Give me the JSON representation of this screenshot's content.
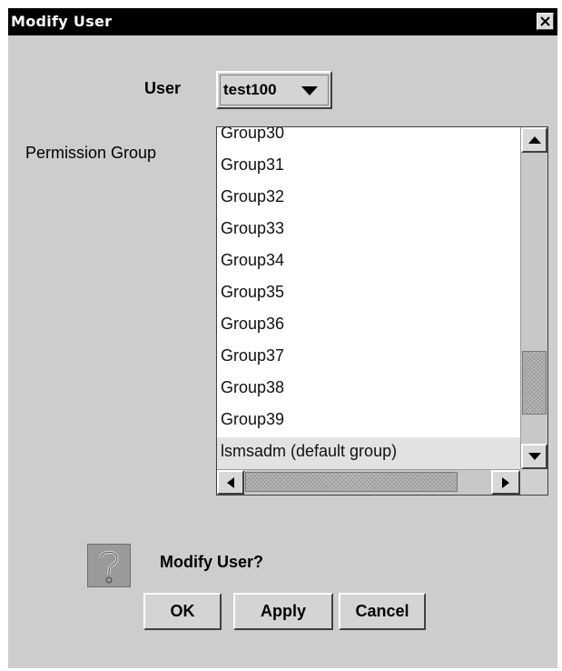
{
  "window": {
    "title": "Modify User",
    "close_icon": "close-icon"
  },
  "user": {
    "label": "User",
    "selected": "test100"
  },
  "permission": {
    "label": "Permission Group",
    "items": [
      "Group30",
      "Group31",
      "Group32",
      "Group33",
      "Group34",
      "Group35",
      "Group36",
      "Group37",
      "Group38",
      "Group39",
      "lsmsadm (default group)"
    ],
    "selected": "lsmsadm (default group)"
  },
  "confirm": {
    "message": "Modify User?",
    "icon": "question-icon"
  },
  "buttons": {
    "ok": "OK",
    "apply": "Apply",
    "cancel": "Cancel"
  }
}
